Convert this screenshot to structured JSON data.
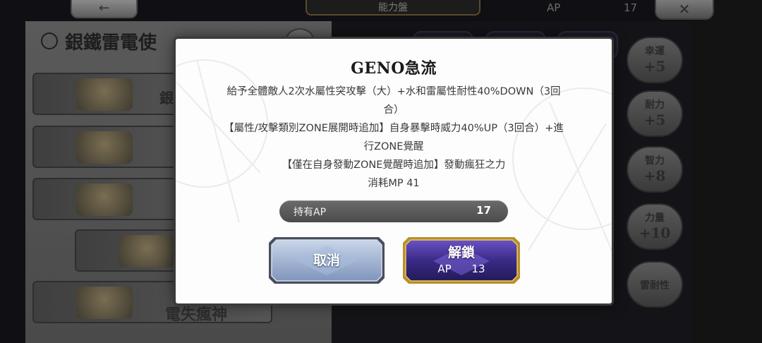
{
  "background": {
    "top_left_icon": "←",
    "top_title": "能力盤",
    "top_ap_label": "AP",
    "top_ap_value": "17",
    "top_right_icon": "✕",
    "character_title": "銀鐵雷電使",
    "rows": [
      {
        "label": "銀"
      },
      {
        "label": ""
      },
      {
        "label": ""
      },
      {
        "label": ""
      },
      {
        "label": "電失瘋神"
      }
    ],
    "stats": [
      {
        "name": "幸運",
        "value": "+5"
      },
      {
        "name": "耐力",
        "value": "+5"
      },
      {
        "name": "智力",
        "value": "+8"
      },
      {
        "name": "力量",
        "value": "+10"
      },
      {
        "name": "雷耐性",
        "value": ""
      }
    ]
  },
  "dialog": {
    "title": "GENO急流",
    "description_lines": [
      "給予全體敵人2次水屬性突攻擊（大）+水和雷屬性耐性40%DOWN（3回",
      "合）",
      "【屬性/攻擊類別ZONE展開時追加】自身暴擊時威力40%UP（3回合）+進",
      "行ZONE覺醒",
      "【僅在自身發動ZONE覺醒時追加】發動瘋狂之力",
      "消耗MP 41"
    ],
    "ap_label": "持有AP",
    "ap_value": "17",
    "cancel_label": "取消",
    "unlock_label": "解鎖",
    "unlock_cost_label": "AP",
    "unlock_cost_value": "13"
  },
  "colors": {
    "dialog_bg": "#fdfdfd",
    "cancel_button": "#8fa6c8",
    "unlock_button": "#3b2a7a",
    "unlock_border": "#c8a040"
  }
}
